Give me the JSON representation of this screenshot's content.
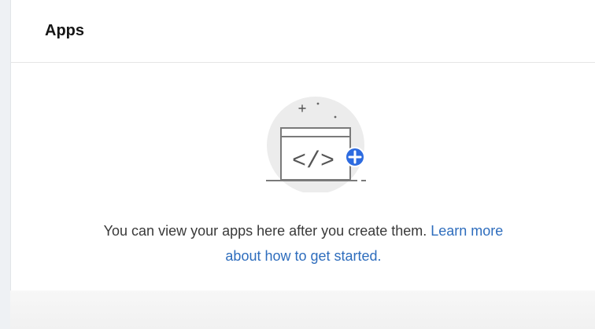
{
  "panel": {
    "title": "Apps"
  },
  "empty_state": {
    "message": "You can view your apps here after you create them.",
    "link_line1": "Learn more",
    "link_line2": "about how to get started.",
    "illustration_icon": "code-window-add-icon",
    "illustration_glyph": "</>"
  },
  "colors": {
    "accent": "#2e6dbd",
    "badge": "#2d6be0",
    "text": "#393939",
    "title": "#161616",
    "circle": "#ececec"
  }
}
